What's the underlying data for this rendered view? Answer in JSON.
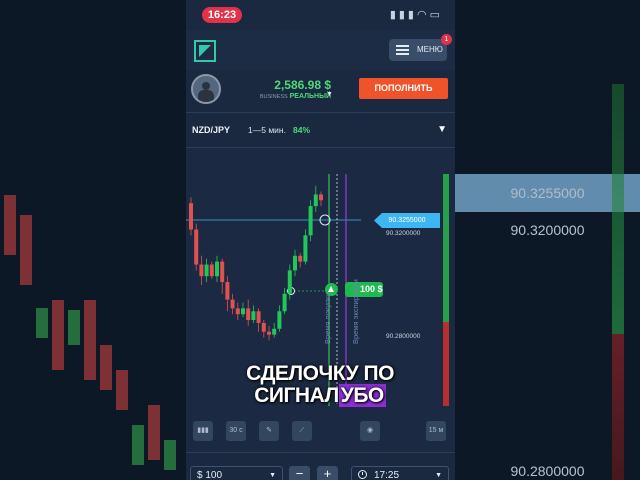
{
  "status": {
    "time": "16:23"
  },
  "header": {
    "menu_label": "МЕНЮ",
    "menu_badge": "1"
  },
  "account": {
    "balance": "2,586.98 $",
    "type_prefix": "BUSINESS",
    "type_label": "РЕАЛЬНЫЙ",
    "deposit_label": "ПОПОЛНИТЬ"
  },
  "asset": {
    "pair": "NZD/JPY",
    "timeframe": "1—5 мин.",
    "payout": "84%"
  },
  "chart": {
    "current_price": "90.3255000",
    "price_upper": "90.3200000",
    "price_lower": "90.2800000",
    "trade_amount": "100 $",
    "vertical_label_1": "Время покупки",
    "vertical_label_2": "Время экспирации",
    "candles": [
      {
        "o": 90.323,
        "c": 90.314,
        "h": 90.325,
        "l": 90.312
      },
      {
        "o": 90.314,
        "c": 90.302,
        "h": 90.316,
        "l": 90.3
      },
      {
        "o": 90.302,
        "c": 90.298,
        "h": 90.305,
        "l": 90.295
      },
      {
        "o": 90.298,
        "c": 90.302,
        "h": 90.304,
        "l": 90.296
      },
      {
        "o": 90.302,
        "c": 90.298,
        "h": 90.303,
        "l": 90.297
      },
      {
        "o": 90.298,
        "c": 90.303,
        "h": 90.305,
        "l": 90.296
      },
      {
        "o": 90.303,
        "c": 90.296,
        "h": 90.304,
        "l": 90.292
      },
      {
        "o": 90.296,
        "c": 90.29,
        "h": 90.298,
        "l": 90.286
      },
      {
        "o": 90.29,
        "c": 90.287,
        "h": 90.292,
        "l": 90.285
      },
      {
        "o": 90.287,
        "c": 90.285,
        "h": 90.289,
        "l": 90.283
      },
      {
        "o": 90.285,
        "c": 90.287,
        "h": 90.289,
        "l": 90.284
      },
      {
        "o": 90.287,
        "c": 90.283,
        "h": 90.29,
        "l": 90.281
      },
      {
        "o": 90.283,
        "c": 90.286,
        "h": 90.288,
        "l": 90.282
      },
      {
        "o": 90.286,
        "c": 90.282,
        "h": 90.287,
        "l": 90.279
      },
      {
        "o": 90.282,
        "c": 90.279,
        "h": 90.283,
        "l": 90.277
      },
      {
        "o": 90.279,
        "c": 90.278,
        "h": 90.281,
        "l": 90.276
      },
      {
        "o": 90.278,
        "c": 90.28,
        "h": 90.282,
        "l": 90.277
      },
      {
        "o": 90.28,
        "c": 90.286,
        "h": 90.288,
        "l": 90.279
      },
      {
        "o": 90.286,
        "c": 90.292,
        "h": 90.294,
        "l": 90.285
      },
      {
        "o": 90.292,
        "c": 90.3,
        "h": 90.302,
        "l": 90.29
      },
      {
        "o": 90.3,
        "c": 90.305,
        "h": 90.307,
        "l": 90.298
      },
      {
        "o": 90.305,
        "c": 90.303,
        "h": 90.306,
        "l": 90.301
      },
      {
        "o": 90.303,
        "c": 90.312,
        "h": 90.314,
        "l": 90.302
      },
      {
        "o": 90.312,
        "c": 90.322,
        "h": 90.324,
        "l": 90.31
      },
      {
        "o": 90.322,
        "c": 90.326,
        "h": 90.329,
        "l": 90.32
      },
      {
        "o": 90.326,
        "c": 90.324,
        "h": 90.327,
        "l": 90.322
      }
    ]
  },
  "toolbar": {
    "interval": "30 c",
    "timeframe": "15 м"
  },
  "order": {
    "amount": "$ 100",
    "minus": "−",
    "plus": "+",
    "expiry": "17:25"
  },
  "caption": {
    "line1": "СДЕЛОЧКУ ПО",
    "line2_a": "СИГНАЛ",
    "line2_b": "УБО"
  },
  "background": {
    "big_price_1": "90.3255000",
    "big_price_2": "90.3200000",
    "big_price_3": "90.2800000"
  },
  "colors": {
    "up": "#22c75a",
    "down": "#e05252",
    "accent": "#f0532a",
    "price_line": "#3db6f2"
  }
}
